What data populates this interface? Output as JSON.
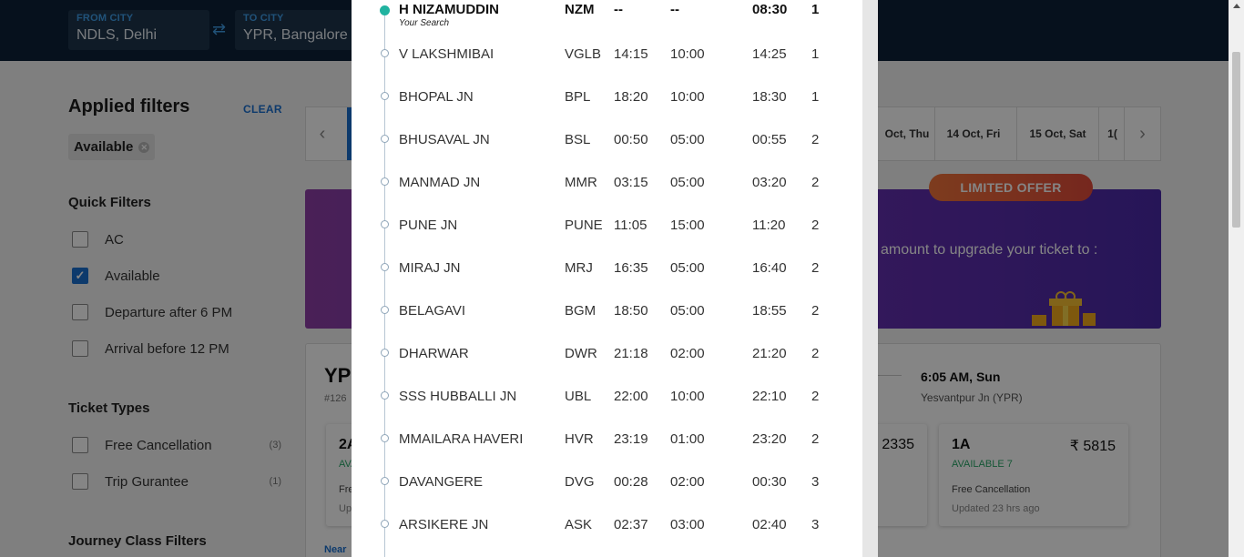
{
  "header": {
    "from_label": "FROM CITY",
    "from_value": "NDLS, Delhi",
    "to_label": "TO CITY",
    "to_value": "YPR, Bangalore",
    "swap_icon": "swap-arrows-icon"
  },
  "sidebar": {
    "applied_title": "Applied filters",
    "clear_label": "CLEAR",
    "chip_label": "Available",
    "quick_filters_title": "Quick Filters",
    "quick_filters": [
      {
        "label": "AC",
        "checked": false
      },
      {
        "label": "Available",
        "checked": true
      },
      {
        "label": "Departure after 6 PM",
        "checked": false
      },
      {
        "label": "Arrival before 12 PM",
        "checked": false
      }
    ],
    "ticket_types_title": "Ticket Types",
    "ticket_types": [
      {
        "label": "Free Cancellation",
        "count": "(3)"
      },
      {
        "label": "Trip Gurantee",
        "count": "(1)"
      }
    ],
    "journey_class_title": "Journey Class Filters"
  },
  "date_strip": {
    "dates": [
      "Oct, Thu",
      "14 Oct, Fri",
      "15 Oct, Sat",
      "1("
    ]
  },
  "offer": {
    "badge": "LIMITED OFFER",
    "text": "amount to upgrade your ticket to :"
  },
  "train": {
    "name": "YPI",
    "number": "#126",
    "arrival_time": "6:05 AM, Sun",
    "arrival_station": "Yesvantpur Jn (YPR)",
    "nearby": "Near",
    "classes": [
      {
        "cls": "2A",
        "price": "",
        "avail": "AVA",
        "fc": "Fre",
        "upd": "Up"
      },
      {
        "cls": "",
        "price": "2335",
        "avail": "",
        "fc": "",
        "upd": ""
      },
      {
        "cls": "1A",
        "price": "₹ 5815",
        "avail": "AVAILABLE 7",
        "fc": "Free Cancellation",
        "upd": "Updated 23 hrs ago"
      }
    ]
  },
  "schedule": {
    "your_search_label": "Your Search",
    "stops": [
      {
        "name": "H NIZAMUDDIN",
        "code": "NZM",
        "arr": "--",
        "halt": "--",
        "dep": "08:30",
        "day": "1",
        "current": true
      },
      {
        "name": "V LAKSHMIBAI",
        "code": "VGLB",
        "arr": "14:15",
        "halt": "10:00",
        "dep": "14:25",
        "day": "1"
      },
      {
        "name": "BHOPAL JN",
        "code": "BPL",
        "arr": "18:20",
        "halt": "10:00",
        "dep": "18:30",
        "day": "1"
      },
      {
        "name": "BHUSAVAL JN",
        "code": "BSL",
        "arr": "00:50",
        "halt": "05:00",
        "dep": "00:55",
        "day": "2"
      },
      {
        "name": "MANMAD JN",
        "code": "MMR",
        "arr": "03:15",
        "halt": "05:00",
        "dep": "03:20",
        "day": "2"
      },
      {
        "name": "PUNE JN",
        "code": "PUNE",
        "arr": "11:05",
        "halt": "15:00",
        "dep": "11:20",
        "day": "2"
      },
      {
        "name": "MIRAJ JN",
        "code": "MRJ",
        "arr": "16:35",
        "halt": "05:00",
        "dep": "16:40",
        "day": "2"
      },
      {
        "name": "BELAGAVI",
        "code": "BGM",
        "arr": "18:50",
        "halt": "05:00",
        "dep": "18:55",
        "day": "2"
      },
      {
        "name": "DHARWAR",
        "code": "DWR",
        "arr": "21:18",
        "halt": "02:00",
        "dep": "21:20",
        "day": "2"
      },
      {
        "name": "SSS HUBBALLI JN",
        "code": "UBL",
        "arr": "22:00",
        "halt": "10:00",
        "dep": "22:10",
        "day": "2"
      },
      {
        "name": "MMAILARA HAVERI",
        "code": "HVR",
        "arr": "23:19",
        "halt": "01:00",
        "dep": "23:20",
        "day": "2"
      },
      {
        "name": "DAVANGERE",
        "code": "DVG",
        "arr": "00:28",
        "halt": "02:00",
        "dep": "00:30",
        "day": "3"
      },
      {
        "name": "ARSIKERE JN",
        "code": "ASK",
        "arr": "02:37",
        "halt": "03:00",
        "dep": "02:40",
        "day": "3"
      }
    ]
  }
}
